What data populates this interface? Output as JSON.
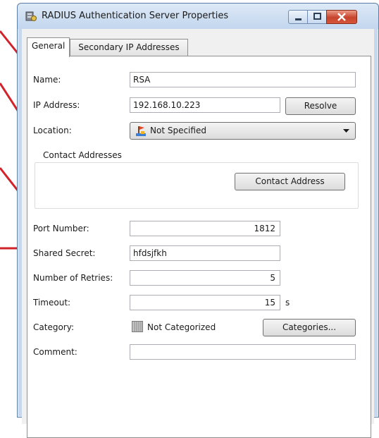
{
  "window": {
    "title": "RADIUS Authentication Server Properties"
  },
  "tabs": [
    {
      "label": "General",
      "active": true
    },
    {
      "label": "Secondary IP Addresses",
      "active": false
    }
  ],
  "form": {
    "name": {
      "label": "Name:",
      "value": "RSA"
    },
    "ip_address": {
      "label": "IP Address:",
      "value": "192.168.10.223",
      "button": "Resolve"
    },
    "location": {
      "label": "Location:",
      "value": "Not Specified"
    },
    "contact": {
      "group_label": "Contact Addresses",
      "button": "Contact Address"
    },
    "port_number": {
      "label": "Port Number:",
      "value": "1812"
    },
    "shared_secret": {
      "label": "Shared Secret:",
      "value": "hfdsjfkh"
    },
    "retries": {
      "label": "Number of Retries:",
      "value": "5"
    },
    "timeout": {
      "label": "Timeout:",
      "value": "15",
      "unit": "s"
    },
    "category": {
      "label": "Category:",
      "value": "Not Categorized",
      "button": "Categories..."
    },
    "comment": {
      "label": "Comment:",
      "value": ""
    }
  },
  "colors": {
    "callout": "#d2232a",
    "close_button": "#c7442c",
    "title_bar": "#c7d8ec"
  },
  "icons": {
    "app": "server-properties-icon",
    "location": "location-pin-icon",
    "category": "category-swatch-icon",
    "dropdown": "chevron-down-icon"
  }
}
